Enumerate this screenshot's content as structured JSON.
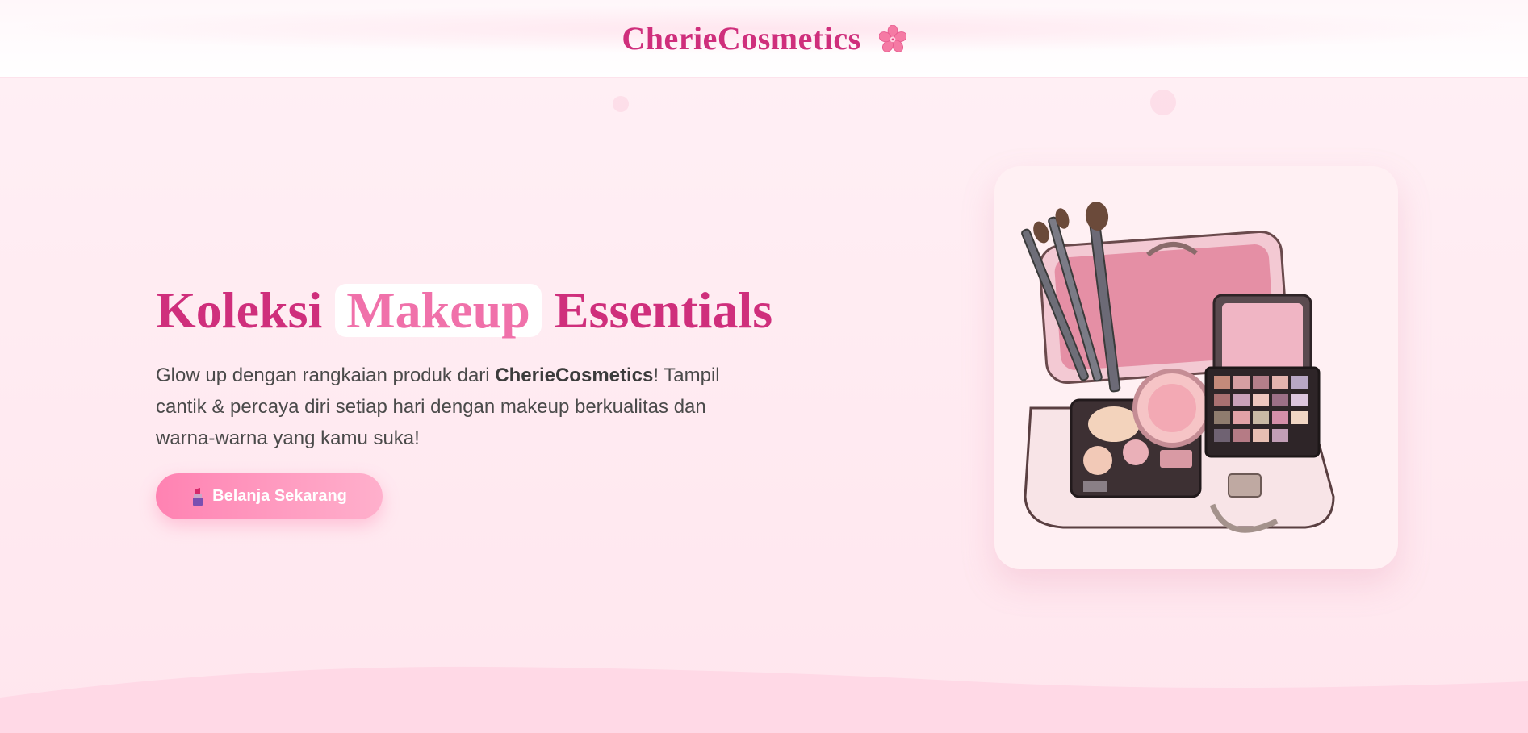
{
  "header": {
    "brand_name": "CherieCosmetics",
    "brand_icon": "cherry-blossom-icon"
  },
  "hero": {
    "title_part1": "Koleksi",
    "title_highlight": "Makeup",
    "title_part2": "Essentials",
    "desc_before": "Glow up dengan rangkaian produk dari ",
    "desc_brand": "CherieCosmetics",
    "desc_after": "! Tampil cantik & percaya diri setiap hari dengan makeup berkualitas dan warna-warna yang kamu suka!",
    "cta_label": "Belanja Sekarang",
    "cta_icon": "lipstick-icon"
  },
  "product_card": {
    "image_subject": "makeup-case-illustration"
  },
  "colors": {
    "brand_pink": "#cf2f7c",
    "accent_pink": "#f071aa",
    "button_start": "#ff82b2",
    "button_end": "#ffb0cc",
    "background": "#ffe9f0"
  }
}
